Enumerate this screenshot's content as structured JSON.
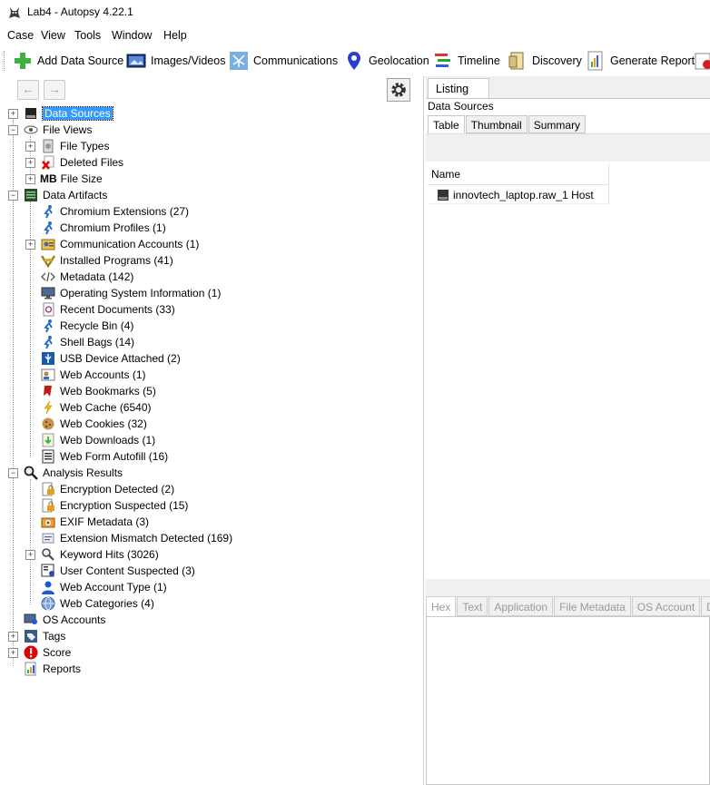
{
  "window": {
    "title": "Lab4 - Autopsy 4.22.1"
  },
  "menu": [
    "Case",
    "View",
    "Tools",
    "Window",
    "Help"
  ],
  "toolbar": {
    "add_data_source": "Add Data Source",
    "images_videos": "Images/Videos",
    "communications": "Communications",
    "geolocation": "Geolocation",
    "timeline": "Timeline",
    "discovery": "Discovery",
    "generate_report": "Generate Report"
  },
  "nav": {
    "back_icon": "arrow-left-icon",
    "forward_icon": "arrow-right-icon",
    "settings_icon": "gear-icon"
  },
  "tree": {
    "data_sources": "Data Sources",
    "file_views": "File Views",
    "file_types": "File Types",
    "deleted_files": "Deleted Files",
    "file_size": "File Size",
    "file_size_badge": "MB",
    "data_artifacts": "Data Artifacts",
    "artifacts": [
      "Chromium Extensions (27)",
      "Chromium Profiles (1)",
      "Communication Accounts (1)",
      "Installed Programs (41)",
      "Metadata (142)",
      "Operating System Information (1)",
      "Recent Documents (33)",
      "Recycle Bin (4)",
      "Shell Bags (14)",
      "USB Device Attached (2)",
      "Web Accounts (1)",
      "Web Bookmarks (5)",
      "Web Cache (6540)",
      "Web Cookies (32)",
      "Web Downloads (1)",
      "Web Form Autofill (16)"
    ],
    "analysis_results": "Analysis Results",
    "results": [
      "Encryption Detected (2)",
      "Encryption Suspected (15)",
      "EXIF Metadata (3)",
      "Extension Mismatch Detected (169)",
      "Keyword Hits (3026)",
      "User Content Suspected (3)",
      "Web Account Type (1)",
      "Web Categories (4)"
    ],
    "os_accounts": "OS Accounts",
    "tags": "Tags",
    "score": "Score",
    "reports": "Reports"
  },
  "listing": {
    "tab": "Listing",
    "breadcrumb": "Data Sources",
    "subtabs": [
      "Table",
      "Thumbnail",
      "Summary"
    ],
    "column_name": "Name",
    "rows": [
      "innovtech_laptop.raw_1 Host"
    ]
  },
  "content_viewer": {
    "tabs": [
      "Hex",
      "Text",
      "Application",
      "File Metadata",
      "OS Account",
      "Da"
    ]
  },
  "colors": {
    "selection": "#3399ff",
    "accent_green": "#3cb043",
    "score_red": "#e00000"
  }
}
